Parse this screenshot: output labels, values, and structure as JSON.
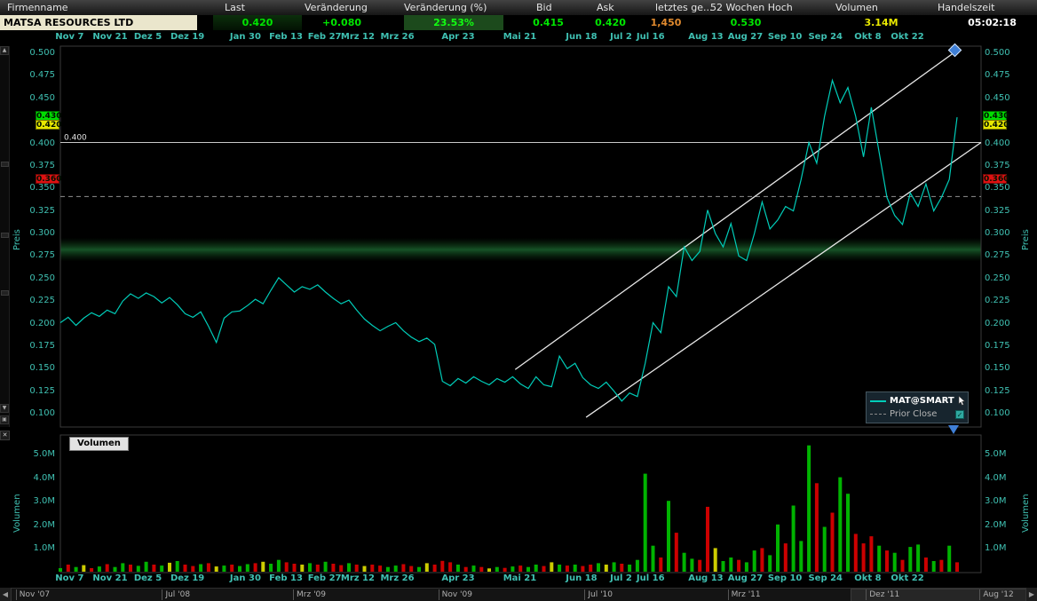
{
  "quote_header": {
    "columns": [
      {
        "label": "Firmenname"
      },
      {
        "label": "Last"
      },
      {
        "label": "Veränderung"
      },
      {
        "label": "Veränderung (%)"
      },
      {
        "label": "Bid"
      },
      {
        "label": "Ask"
      },
      {
        "label": "letztes ge..."
      },
      {
        "label": "52 Wochen Hoch"
      },
      {
        "label": "Volumen"
      },
      {
        "label": "Handelszeit"
      }
    ],
    "company": "MATSA RESOURCES LTD",
    "last": "0.420",
    "change": "+0.080",
    "change_pct": "23.53%",
    "bid": "0.415",
    "ask": "0.420",
    "last_qty": "1,450",
    "high_52w": "0.530",
    "volume": "3.14M",
    "trade_time": "05:02:18"
  },
  "icons": {
    "scroll_up": "▲",
    "scroll_down": "▼",
    "scroll_left": "◀",
    "scroll_right": "▶",
    "close": "✕",
    "panel": "▣",
    "checkmark": "✓"
  },
  "price_axis": {
    "label_left": "Preis",
    "label_right": "Preis",
    "ticks": [
      "0.500",
      "0.475",
      "0.450",
      "0.400",
      "0.375",
      "0.350",
      "0.325",
      "0.300",
      "0.275",
      "0.250",
      "0.225",
      "0.200",
      "0.175",
      "0.150",
      "0.125",
      "0.100"
    ],
    "markers": [
      {
        "value": "0.430",
        "color": "#00DD00"
      },
      {
        "value": "0.420",
        "color": "#E8E800"
      },
      {
        "value": "0.360",
        "color": "#DD1111"
      }
    ]
  },
  "legend": {
    "series_label": "MAT@SMART",
    "prior_close_label": "Prior Close"
  },
  "volume_axis": {
    "title": "Volumen",
    "label_left": "Volumen",
    "label_right": "Volumen",
    "ticks": [
      "5.0M",
      "4.0M",
      "3.0M",
      "2.0M",
      "1.0M"
    ]
  },
  "timeline": {
    "labels": [
      {
        "label": "Nov '07",
        "pos": 0.005
      },
      {
        "label": "Jul '08",
        "pos": 0.149
      },
      {
        "label": "Mrz '09",
        "pos": 0.278
      },
      {
        "label": "Nov '09",
        "pos": 0.421
      },
      {
        "label": "Jul '10",
        "pos": 0.565
      },
      {
        "label": "Mrz '11",
        "pos": 0.706
      },
      {
        "label": "Dez '11",
        "pos": 0.842
      },
      {
        "label": "Aug '12",
        "pos": 0.954
      }
    ]
  },
  "colors": {
    "series": "#00CDB9",
    "axis_labels": "#3FC0B2",
    "up": "#00B300",
    "down": "#CC0000",
    "neutral": "#CCCC00",
    "trend_line": "#E8E8E8",
    "prior_close_line": "#909090",
    "level_line": "#C8C8C8"
  },
  "chart_data": {
    "type": "line",
    "series_name": "MAT@SMART",
    "ylim": [
      0.1,
      0.5
    ],
    "volume_ylim_m": [
      0,
      5.5
    ],
    "x_labels": [
      {
        "label": "Nov 7",
        "pos": 0.01
      },
      {
        "label": "Nov 21",
        "pos": 0.054
      },
      {
        "label": "Dez 5",
        "pos": 0.095
      },
      {
        "label": "Dez 19",
        "pos": 0.138
      },
      {
        "label": "Jan 30",
        "pos": 0.201
      },
      {
        "label": "Feb 13",
        "pos": 0.245
      },
      {
        "label": "Feb 27",
        "pos": 0.287
      },
      {
        "label": "Mrz 12",
        "pos": 0.323
      },
      {
        "label": "Mrz 26",
        "pos": 0.366
      },
      {
        "label": "Apr 23",
        "pos": 0.432
      },
      {
        "label": "Mai 21",
        "pos": 0.499
      },
      {
        "label": "Jun 18",
        "pos": 0.566
      },
      {
        "label": "Jul 2",
        "pos": 0.609
      },
      {
        "label": "Jul 16",
        "pos": 0.641
      },
      {
        "label": "Aug 13",
        "pos": 0.701
      },
      {
        "label": "Aug 27",
        "pos": 0.744
      },
      {
        "label": "Sep 10",
        "pos": 0.787
      },
      {
        "label": "Sep 24",
        "pos": 0.831
      },
      {
        "label": "Okt 8",
        "pos": 0.877
      },
      {
        "label": "Okt 22",
        "pos": 0.92
      }
    ],
    "prices": [
      0.2,
      0.206,
      0.197,
      0.205,
      0.211,
      0.207,
      0.214,
      0.21,
      0.224,
      0.232,
      0.227,
      0.233,
      0.229,
      0.222,
      0.228,
      0.22,
      0.21,
      0.206,
      0.212,
      0.196,
      0.178,
      0.205,
      0.212,
      0.213,
      0.219,
      0.226,
      0.221,
      0.236,
      0.25,
      0.242,
      0.234,
      0.24,
      0.237,
      0.242,
      0.234,
      0.227,
      0.221,
      0.225,
      0.214,
      0.204,
      0.197,
      0.191,
      0.196,
      0.2,
      0.191,
      0.184,
      0.179,
      0.183,
      0.176,
      0.135,
      0.13,
      0.138,
      0.133,
      0.14,
      0.135,
      0.131,
      0.138,
      0.134,
      0.14,
      0.132,
      0.127,
      0.14,
      0.131,
      0.129,
      0.163,
      0.149,
      0.155,
      0.139,
      0.131,
      0.127,
      0.134,
      0.124,
      0.113,
      0.122,
      0.118,
      0.155,
      0.2,
      0.189,
      0.24,
      0.229,
      0.284,
      0.269,
      0.279,
      0.325,
      0.299,
      0.284,
      0.31,
      0.274,
      0.269,
      0.299,
      0.334,
      0.304,
      0.314,
      0.329,
      0.324,
      0.359,
      0.4,
      0.377,
      0.429,
      0.469,
      0.444,
      0.461,
      0.429,
      0.384,
      0.439,
      0.389,
      0.339,
      0.319,
      0.309,
      0.344,
      0.329,
      0.354,
      0.324,
      0.339,
      0.359,
      0.428
    ],
    "volumes": [
      0.15,
      0.3,
      0.2,
      0.28,
      0.15,
      0.22,
      0.32,
      0.2,
      0.36,
      0.3,
      0.25,
      0.42,
      0.3,
      0.26,
      0.38,
      0.45,
      0.3,
      0.24,
      0.32,
      0.36,
      0.22,
      0.26,
      0.3,
      0.24,
      0.32,
      0.36,
      0.42,
      0.34,
      0.5,
      0.4,
      0.34,
      0.3,
      0.36,
      0.3,
      0.42,
      0.34,
      0.28,
      0.36,
      0.3,
      0.24,
      0.3,
      0.26,
      0.2,
      0.26,
      0.32,
      0.24,
      0.2,
      0.36,
      0.3,
      0.46,
      0.4,
      0.3,
      0.2,
      0.26,
      0.2,
      0.14,
      0.2,
      0.16,
      0.22,
      0.26,
      0.2,
      0.3,
      0.24,
      0.4,
      0.3,
      0.26,
      0.3,
      0.24,
      0.3,
      0.36,
      0.3,
      0.4,
      0.34,
      0.3,
      0.5,
      4.15,
      1.1,
      0.6,
      3.0,
      1.65,
      0.8,
      0.55,
      0.5,
      2.75,
      1.0,
      0.45,
      0.6,
      0.5,
      0.4,
      0.9,
      1.0,
      0.7,
      2.0,
      1.2,
      2.8,
      1.3,
      5.35,
      3.75,
      1.9,
      2.5,
      4.0,
      3.3,
      1.6,
      1.2,
      1.5,
      1.1,
      0.9,
      0.8,
      0.5,
      1.05,
      1.15,
      0.6,
      0.45,
      0.5,
      1.1,
      0.4
    ],
    "volume_colors": [
      "g",
      "r",
      "g",
      "y",
      "r",
      "g",
      "r",
      "g",
      "g",
      "r",
      "g",
      "g",
      "r",
      "g",
      "y",
      "g",
      "r",
      "r",
      "g",
      "r",
      "y",
      "g",
      "r",
      "g",
      "g",
      "r",
      "y",
      "g",
      "g",
      "r",
      "r",
      "y",
      "g",
      "r",
      "g",
      "r",
      "r",
      "g",
      "r",
      "y",
      "r",
      "r",
      "g",
      "g",
      "r",
      "r",
      "g",
      "y",
      "r",
      "r",
      "r",
      "g",
      "r",
      "g",
      "r",
      "y",
      "g",
      "r",
      "g",
      "r",
      "g",
      "g",
      "r",
      "y",
      "g",
      "r",
      "g",
      "r",
      "r",
      "g",
      "y",
      "g",
      "r",
      "g",
      "g",
      "g",
      "g",
      "r",
      "g",
      "r",
      "g",
      "g",
      "r",
      "r",
      "y",
      "g",
      "g",
      "r",
      "g",
      "g",
      "r",
      "g",
      "g",
      "r",
      "g",
      "g",
      "g",
      "r",
      "g",
      "r",
      "g",
      "g",
      "r",
      "r",
      "r",
      "g",
      "r",
      "g",
      "r",
      "g",
      "g",
      "r",
      "g",
      "r",
      "g",
      "r"
    ],
    "hline": {
      "value": 0.4,
      "label": "0.400"
    },
    "prior_close": 0.34,
    "highlight_band": {
      "from": 0.268,
      "to": 0.294
    },
    "trend_lines": [
      {
        "x1": 0.494,
        "p1": 0.148,
        "x2": 0.971,
        "p2": 0.5
      },
      {
        "x1": 0.571,
        "p1": 0.095,
        "x2": 1.0,
        "p2": 0.4
      }
    ],
    "marker": {
      "x": 0.971,
      "p": 0.505,
      "shape": "diamond",
      "color": "#3F7FD6"
    }
  }
}
